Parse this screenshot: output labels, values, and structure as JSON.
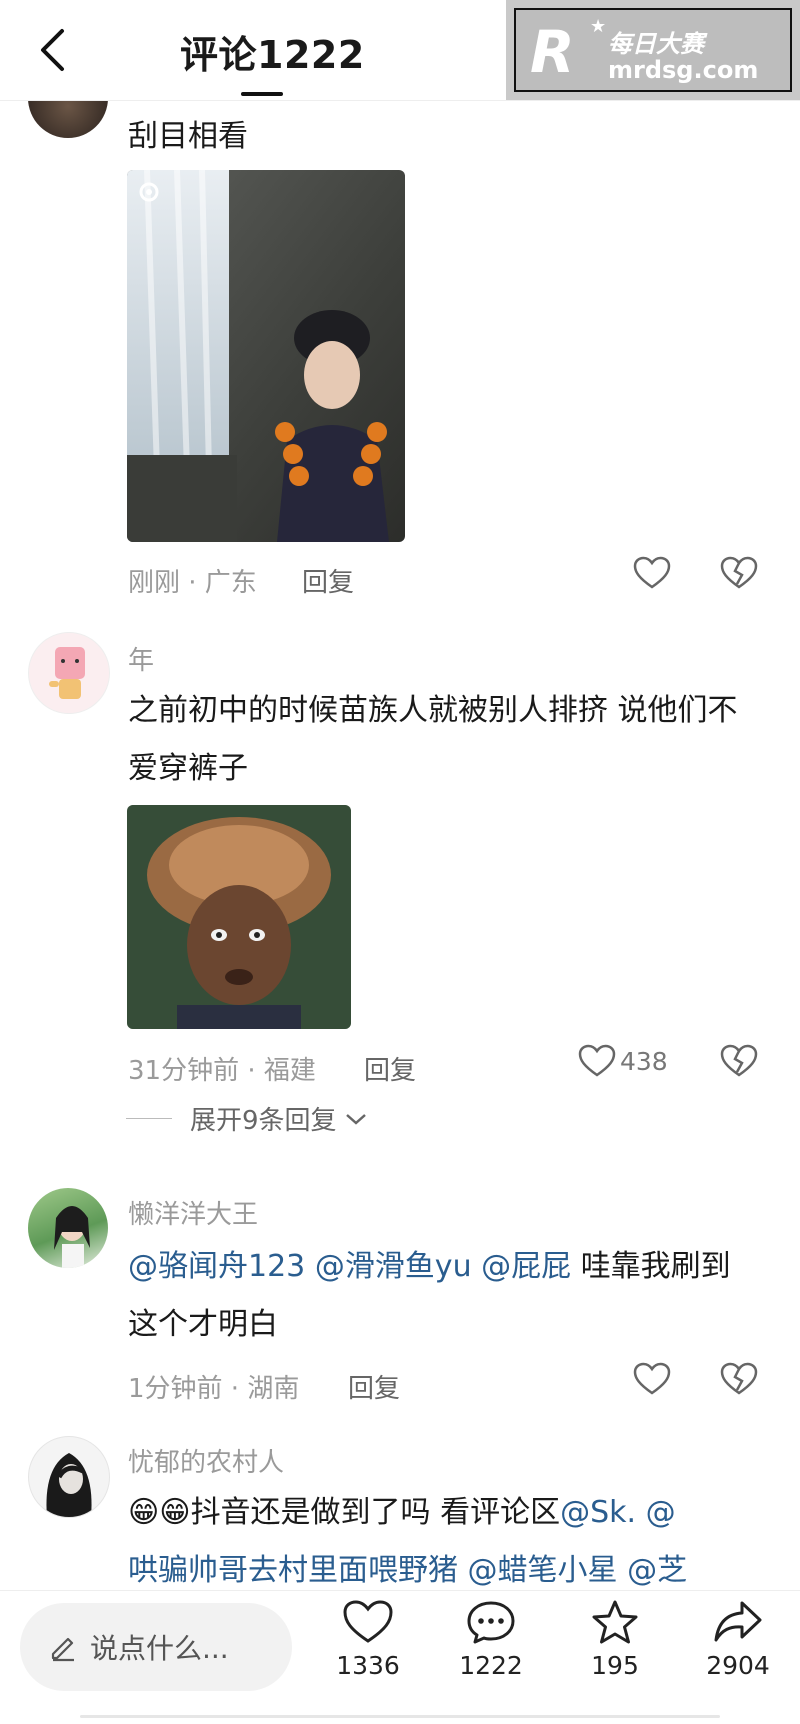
{
  "header": {
    "title": "评论1222"
  },
  "watermark": {
    "logo_letter": "R",
    "brand_cn": "每日大赛",
    "brand_url": "mrdsg.com"
  },
  "comments": [
    {
      "text": "刮目相看",
      "meta": "刚刚 · 广东",
      "reply_label": "回复",
      "likes": ""
    },
    {
      "username": "年",
      "text": "之前初中的时候苗族人就被别人排挤 说他们不爱穿裤子",
      "meta": "31分钟前 · 福建",
      "reply_label": "回复",
      "likes": "438",
      "expand_label": "展开9条回复"
    },
    {
      "username": "懒洋洋大王",
      "mentions": [
        "@骆闻舟123",
        "@滑滑鱼yu",
        "@屁屁"
      ],
      "text": "哇靠我刷到这个才明白",
      "meta": "1分钟前 · 湖南",
      "reply_label": "回复",
      "likes": ""
    },
    {
      "username": "忧郁的农村人",
      "emoji": "😁😁",
      "text": "抖音还是做到了吗 看评论区",
      "mentions": [
        "@Sk.",
        "@",
        "哄骗帅哥去村里面喂野猪",
        "@蜡笔小星",
        "@芝"
      ]
    }
  ],
  "bottom_bar": {
    "input_placeholder": "说点什么...",
    "likes": "1336",
    "comments": "1222",
    "favorites": "195",
    "shares": "2904"
  },
  "colors": {
    "mention": "#2a5d8f",
    "meta": "#9a9a9a",
    "text": "#1a1a1a"
  }
}
